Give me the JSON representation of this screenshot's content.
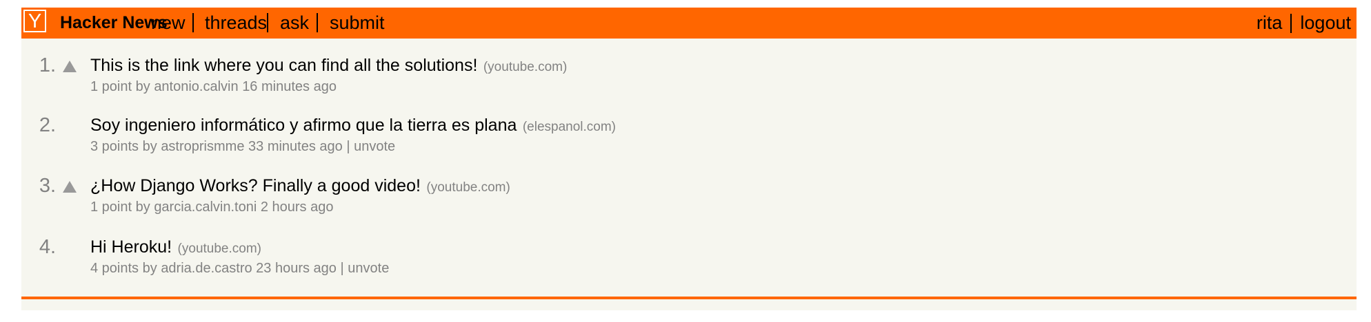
{
  "header": {
    "logo_letter": "Y",
    "site_name": "Hacker News",
    "nav": [
      "new",
      "threads",
      "ask",
      "submit"
    ],
    "user": "rita",
    "logout": "logout",
    "color": "#ff6600"
  },
  "stories": [
    {
      "rank": "1.",
      "has_vote_arrow": true,
      "title": "This is the link where you can find all the solutions!",
      "site": "(youtube.com)",
      "points": "1 point",
      "by": "by",
      "user": "antonio.calvin",
      "age": "16 minutes ago",
      "unvote": ""
    },
    {
      "rank": "2.",
      "has_vote_arrow": false,
      "title": "Soy ingeniero informático y afirmo que la tierra es plana",
      "site": "(elespanol.com)",
      "points": "3 points",
      "by": "by",
      "user": "astroprismme",
      "age": "33 minutes ago",
      "unvote": "unvote"
    },
    {
      "rank": "3.",
      "has_vote_arrow": true,
      "title": "¿How Django Works? Finally a good video!",
      "site": "(youtube.com)",
      "points": "1 point",
      "by": "by",
      "user": "garcia.calvin.toni",
      "age": "2 hours ago",
      "unvote": ""
    },
    {
      "rank": "4.",
      "has_vote_arrow": false,
      "title": "Hi Heroku!",
      "site": "(youtube.com)",
      "points": "4 points",
      "by": "by",
      "user": "adria.de.castro",
      "age": "23 hours ago",
      "unvote": "unvote"
    }
  ]
}
